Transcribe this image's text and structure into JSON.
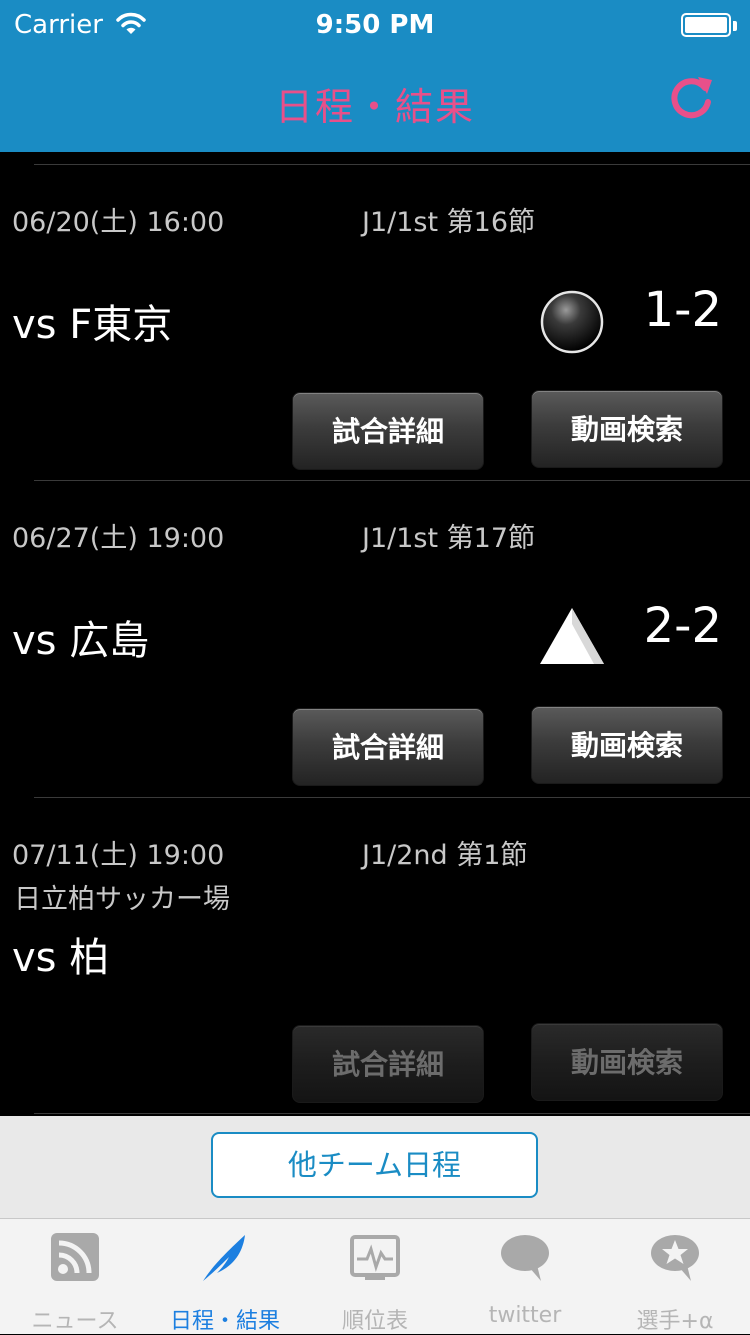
{
  "status_bar": {
    "carrier": "Carrier",
    "time": "9:50 PM"
  },
  "nav": {
    "title": "日程・結果",
    "refresh_icon": "refresh-icon"
  },
  "matches": [
    {
      "date": "06/20(土) 16:00",
      "round": "J1/1st 第16節",
      "venue": "",
      "opponent": "vs F東京",
      "result_icon": "black-circle-loss-icon",
      "score": "1-2",
      "detail_label": "試合詳細",
      "video_label": "動画検索",
      "buttons_enabled": true
    },
    {
      "date": "06/27(土) 19:00",
      "round": "J1/1st 第17節",
      "venue": "",
      "opponent": "vs 広島",
      "result_icon": "white-triangle-draw-icon",
      "score": "2-2",
      "detail_label": "試合詳細",
      "video_label": "動画検索",
      "buttons_enabled": true
    },
    {
      "date": "07/11(土) 19:00",
      "round": "J1/2nd 第1節",
      "venue": "日立柏サッカー場",
      "opponent": "vs 柏",
      "result_icon": "",
      "score": "",
      "detail_label": "試合詳細",
      "video_label": "動画検索",
      "buttons_enabled": false
    }
  ],
  "footer": {
    "other_teams_label": "他チーム日程"
  },
  "tabs": [
    {
      "label": "ニュース",
      "icon": "rss-icon",
      "active": false
    },
    {
      "label": "日程・結果",
      "icon": "feather-icon",
      "active": true
    },
    {
      "label": "順位表",
      "icon": "chart-icon",
      "active": false
    },
    {
      "label": "twitter",
      "icon": "speech-bubble-icon",
      "active": false
    },
    {
      "label": "選手+α",
      "icon": "star-bubble-icon",
      "active": false
    }
  ],
  "colors": {
    "nav_bg": "#1a8cc4",
    "title": "#e8508a",
    "tab_active": "#1c7fe0"
  }
}
